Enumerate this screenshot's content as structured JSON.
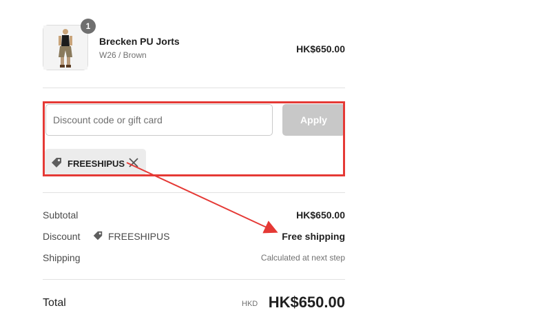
{
  "product": {
    "quantity_badge": "1",
    "name": "Brecken PU Jorts",
    "variant": "W26 / Brown",
    "price": "HK$650.00",
    "image_icon": "product-photo"
  },
  "discount": {
    "input_placeholder": "Discount code or gift card",
    "input_value": "",
    "apply_label": "Apply",
    "applied_code": "FREESHIPUS",
    "tag_icon": "tag-icon",
    "remove_icon": "close-icon"
  },
  "summary": {
    "subtotal_label": "Subtotal",
    "subtotal_value": "HK$650.00",
    "discount_label": "Discount",
    "discount_code": "FREESHIPUS",
    "discount_value": "Free shipping",
    "shipping_label": "Shipping",
    "shipping_value": "Calculated at next step"
  },
  "total": {
    "label": "Total",
    "currency": "HKD",
    "amount": "HK$650.00"
  },
  "annotation": {
    "highlight_color": "#e53935",
    "arrow_color": "#e53935"
  }
}
